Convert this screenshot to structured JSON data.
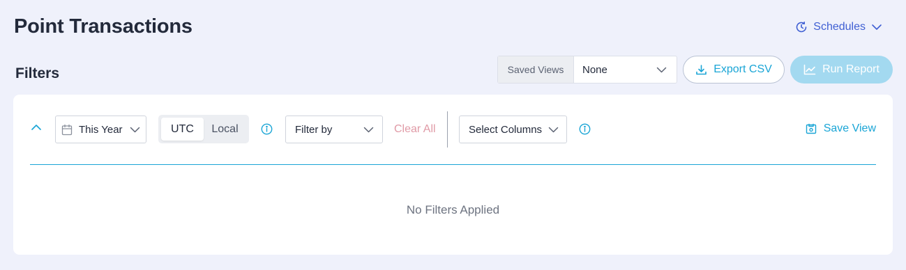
{
  "page": {
    "title": "Point Transactions",
    "schedules_label": "Schedules"
  },
  "filters": {
    "title": "Filters",
    "saved_views": {
      "label": "Saved Views",
      "value": "None"
    },
    "export_label": "Export CSV",
    "run_label": "Run Report",
    "date_range": "This Year",
    "timezone": {
      "options": [
        "UTC",
        "Local"
      ],
      "selected": "UTC"
    },
    "filter_by_label": "Filter by",
    "clear_all_label": "Clear All",
    "select_columns_label": "Select Columns",
    "save_view_label": "Save View",
    "empty_message": "No Filters Applied"
  },
  "icons": {
    "schedules": "schedule-clock-icon",
    "export": "download-icon",
    "run": "trend-chart-icon",
    "collapse": "chevron-up-icon",
    "date": "calendar-icon",
    "info": "info-circle-icon",
    "save_view": "save-view-icon",
    "dropdown": "chevron-down-icon"
  },
  "colors": {
    "accent": "#1aa5d6",
    "link_blue": "#3f5fd3",
    "clear_all": "#e09aa6",
    "run_disabled": "#a3d9f0",
    "background": "#eff1fb"
  }
}
